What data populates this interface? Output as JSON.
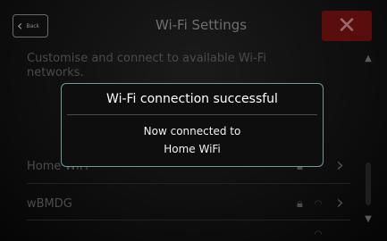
{
  "header": {
    "back_label": "Back",
    "title": "Wi-Fi Settings",
    "close_symbol": "✕"
  },
  "description": "Customise and connect to available Wi-Fi networks.",
  "networks": [
    {
      "name": "Home WiFi",
      "locked": true
    },
    {
      "name": "wBMDG",
      "locked": true
    }
  ],
  "modal": {
    "title": "Wi-Fi connection successful",
    "message_line1": "Now connected to",
    "message_line2": "Home WiFi"
  },
  "icons": {
    "back": "chevron-left-icon",
    "close": "close-icon",
    "lock": "lock-icon",
    "wifi": "wifi-signal-icon",
    "arrow": "chevron-right-icon",
    "scroll_up": "triangle-up-icon",
    "scroll_down": "triangle-down-icon"
  },
  "colors": {
    "close_bg": "#5a0d0d",
    "modal_border": "#6f9a9c",
    "modal_text": "#ffffff"
  }
}
